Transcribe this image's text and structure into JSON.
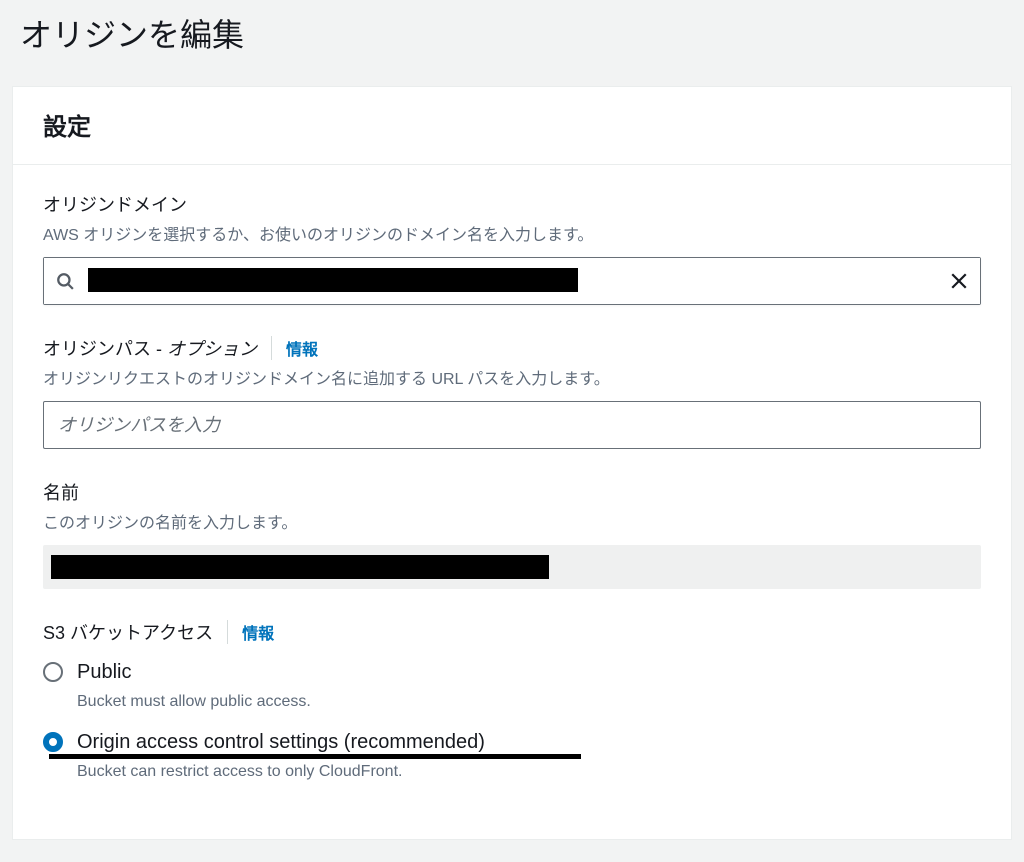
{
  "page": {
    "title": "オリジンを編集"
  },
  "panel": {
    "title": "設定"
  },
  "fields": {
    "origin_domain": {
      "label": "オリジンドメイン",
      "description": "AWS オリジンを選択するか、お使いのオリジンのドメイン名を入力します。",
      "value": ""
    },
    "origin_path": {
      "label": "オリジンパス - ",
      "optional": "オプション",
      "info": "情報",
      "description": "オリジンリクエストのオリジンドメイン名に追加する URL パスを入力します。",
      "placeholder": "オリジンパスを入力",
      "value": ""
    },
    "name": {
      "label": "名前",
      "description": "このオリジンの名前を入力します。",
      "value": ""
    },
    "s3_bucket_access": {
      "label": "S3 バケットアクセス",
      "info": "情報",
      "options": [
        {
          "label": "Public",
          "description": "Bucket must allow public access.",
          "selected": false
        },
        {
          "label": "Origin access control settings (recommended)",
          "description": "Bucket can restrict access to only CloudFront.",
          "selected": true
        }
      ]
    }
  }
}
